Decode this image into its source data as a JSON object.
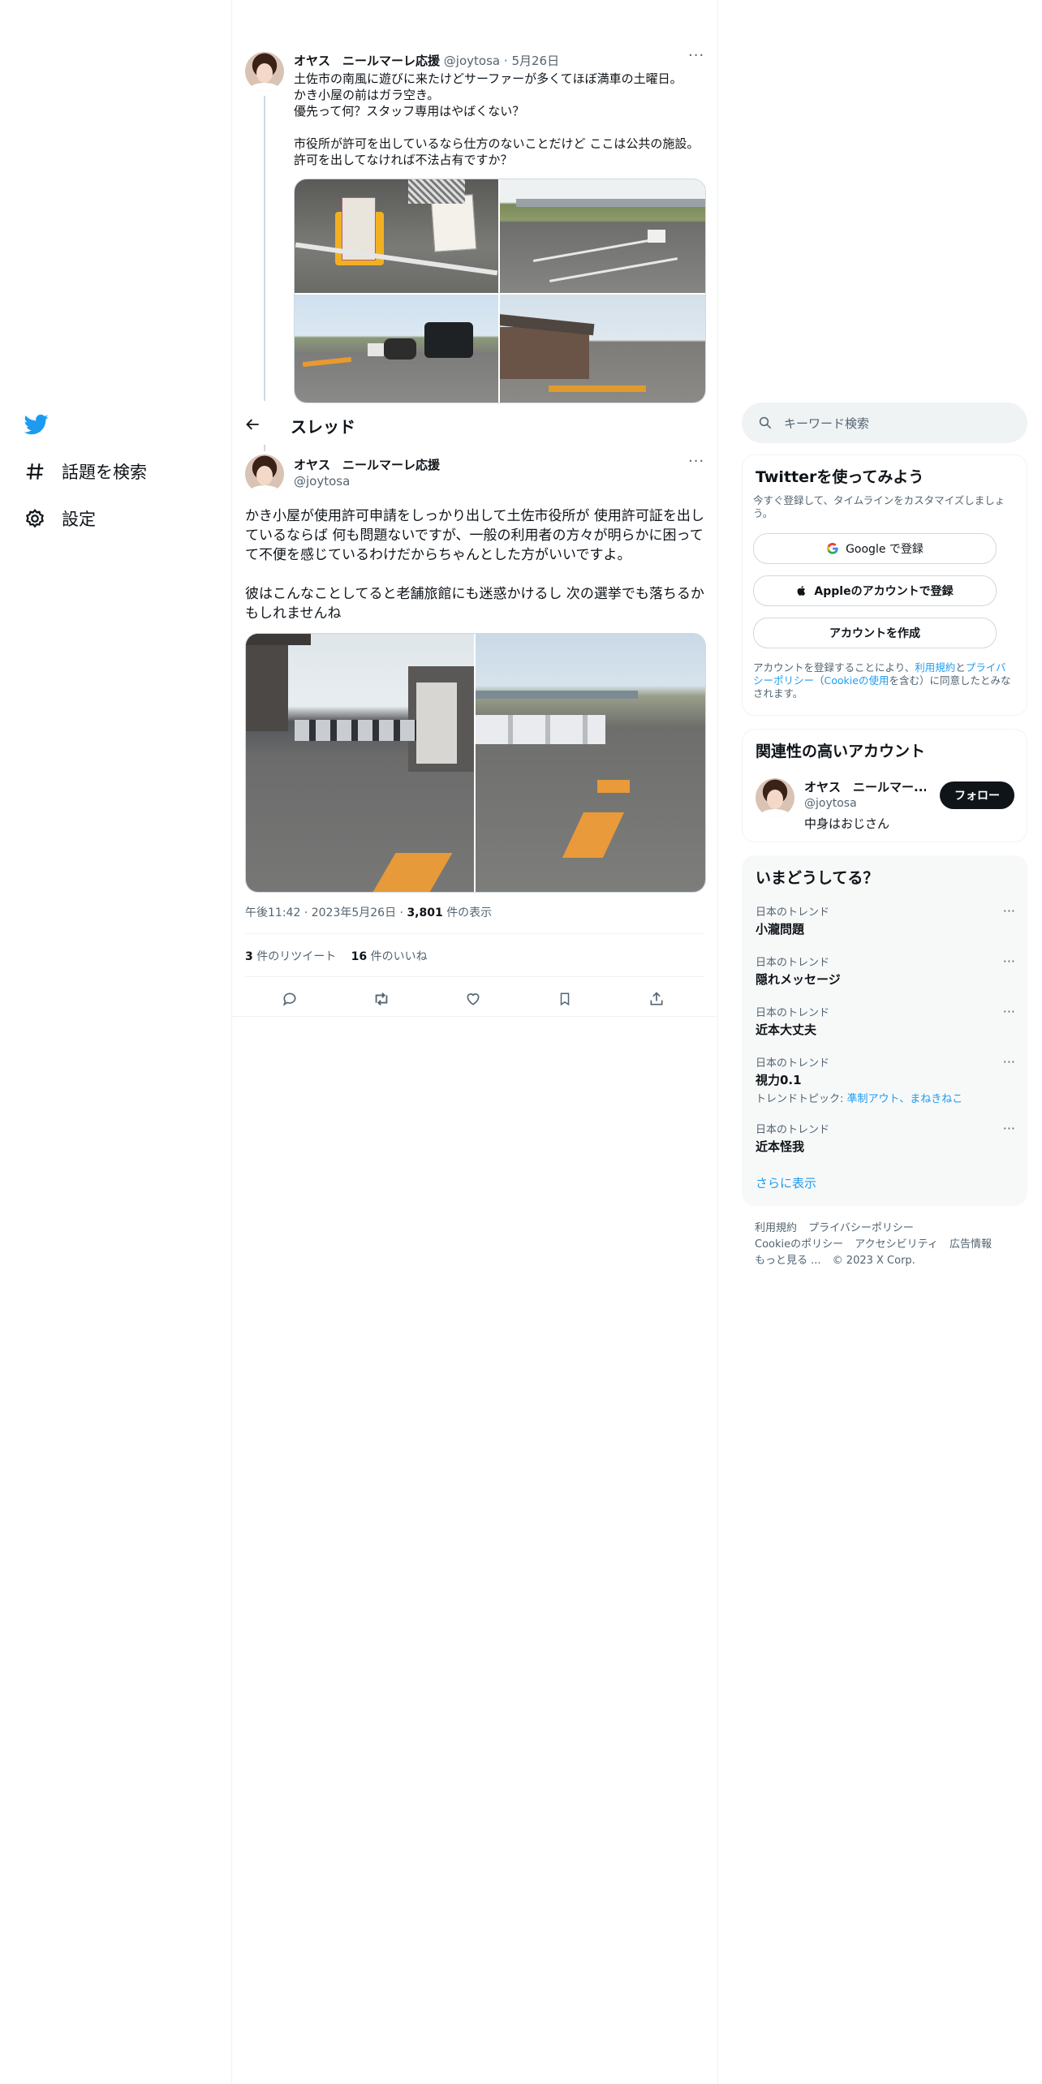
{
  "nav": {
    "items": [
      {
        "label": "話題を検索",
        "icon": "hashtag-icon"
      },
      {
        "label": "設定",
        "icon": "gear-icon"
      }
    ]
  },
  "header": {
    "title": "スレッド"
  },
  "parent_tweet": {
    "author_name": "オヤス　ニールマーレ応援",
    "handle": "@joytosa",
    "date": "5月26日",
    "text": "土佐市の南風に遊びに来たけどサーファーが多くてほぼ満車の土曜日。\nかき小屋の前はガラ空き。\n優先って何？スタッフ専用はやばくない？\n\n市役所が許可を出しているなら仕方のないことだけど ここは公共の施設。\n許可を出してなければ不法占有ですか？"
  },
  "main_tweet": {
    "author_name": "オヤス　ニールマーレ応援",
    "handle": "@joytosa",
    "text": "かき小屋が使用許可申請をしっかり出して土佐市役所が 使用許可証を出しているならば 何も問題ないですが、一般の利用者の方々が明らかに困ってて不便を感じているわけだからちゃんとした方がいいですよ。\n\n彼はこんなことしてると老舗旅館にも迷惑かけるし 次の選挙でも落ちるかもしれませんね",
    "time": "午後11:42",
    "date": "2023年5月26日",
    "views_count": "3,801",
    "views_label": "件の表示",
    "retweets_count": "3",
    "retweets_label": "件のリツイート",
    "likes_count": "16",
    "likes_label": "件のいいね"
  },
  "search": {
    "placeholder": "キーワード検索"
  },
  "signup": {
    "title": "Twitterを使ってみよう",
    "subtitle": "今すぐ登録して、タイムラインをカスタマイズしましょう。",
    "google_label": "Google で登録",
    "apple_label": "Appleのアカウントで登録",
    "create_label": "アカウントを作成",
    "legal_prefix": "アカウントを登録することにより、",
    "terms": "利用規約",
    "and": "と",
    "privacy": "プライバシーポリシー",
    "paren_open": "（",
    "cookie": "Cookieの使用",
    "legal_suffix": "を含む）に同意したとみなされます。"
  },
  "related": {
    "title": "関連性の高いアカウント",
    "name": "オヤス　ニールマー...",
    "handle": "@joytosa",
    "bio": "中身はおじさん",
    "follow_label": "フォロー"
  },
  "trends": {
    "title": "いまどうしてる？",
    "items": [
      {
        "label": "日本のトレンド",
        "title": "小瀧問題"
      },
      {
        "label": "日本のトレンド",
        "title": "隠れメッセージ"
      },
      {
        "label": "日本のトレンド",
        "title": "近本大丈夫"
      },
      {
        "label": "日本のトレンド",
        "title": "視力0.1",
        "topic_prefix": "トレンドトピック: ",
        "topic_links": "凖制アウト、まねきねこ"
      },
      {
        "label": "日本のトレンド",
        "title": "近本怪我"
      }
    ],
    "show_more": "さらに表示"
  },
  "footer": {
    "terms": "利用規約",
    "privacy": "プライバシーポリシー",
    "cookie": "Cookieのポリシー",
    "accessibility": "アクセシビリティ",
    "ads": "広告情報",
    "more": "もっと見る ...",
    "copyright": "© 2023 X Corp."
  },
  "colors": {
    "accent": "#1d9bf0",
    "text": "#0f1419",
    "muted": "#536471",
    "border": "#eff3f4"
  }
}
